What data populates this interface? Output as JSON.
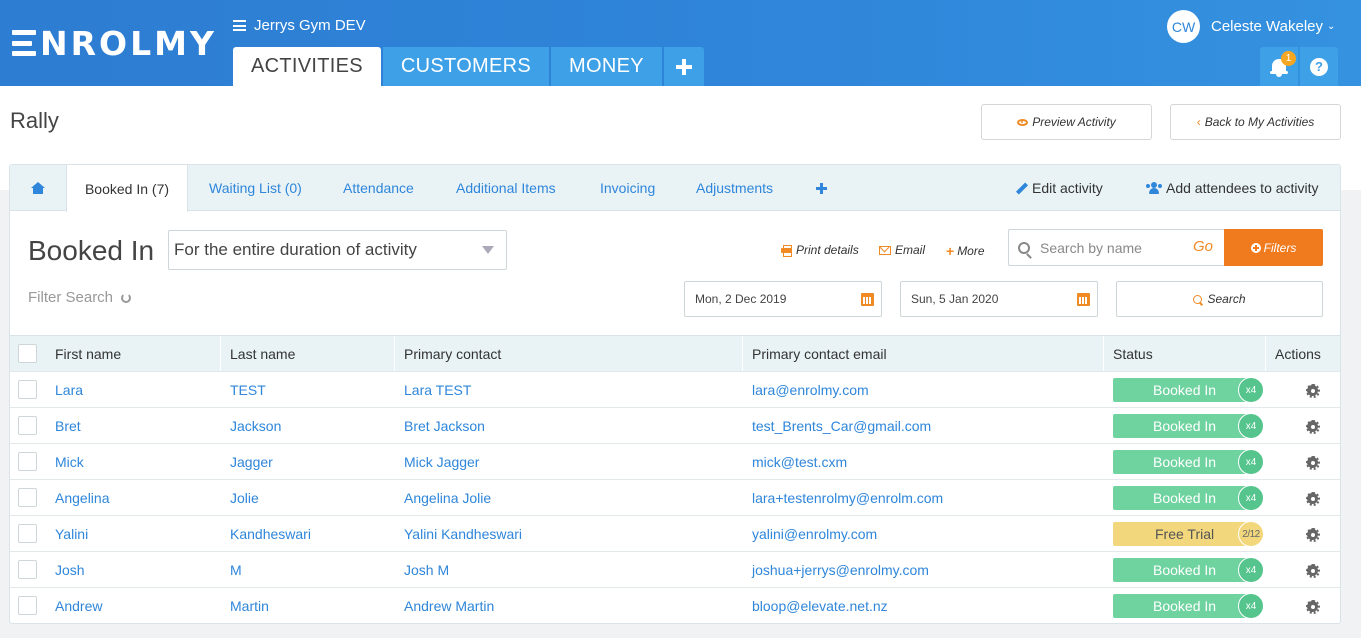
{
  "header": {
    "logo_text": "NROLMY",
    "gym_name": "Jerrys Gym DEV",
    "tabs": [
      {
        "label": "ACTIVITIES"
      },
      {
        "label": "CUSTOMERS"
      },
      {
        "label": "MONEY"
      }
    ],
    "user": {
      "initials": "CW",
      "name": "Celeste Wakeley"
    },
    "notification_count": "1",
    "help_label": "?"
  },
  "page": {
    "title": "Rally",
    "preview_label": "Preview Activity",
    "back_label": "Back to My Activities"
  },
  "subtabs": {
    "items": [
      {
        "label": "Booked In (7)"
      },
      {
        "label": "Waiting List (0)"
      },
      {
        "label": "Attendance"
      },
      {
        "label": "Additional Items"
      },
      {
        "label": "Invoicing"
      },
      {
        "label": "Adjustments"
      }
    ],
    "edit_label": "Edit activity",
    "add_attendees_label": "Add attendees to activity"
  },
  "section": {
    "title": "Booked In",
    "duration_value": "For the entire duration of activity",
    "print_label": "Print details",
    "email_label": "Email",
    "more_label": "More",
    "search_placeholder": "Search by name",
    "go_label": "Go",
    "filters_label": "Filters",
    "filter_search_label": "Filter Search",
    "date_start": "Mon, 2 Dec 2019",
    "date_end": "Sun, 5 Jan 2020",
    "search_button_label": "Search"
  },
  "table": {
    "columns": [
      "First name",
      "Last name",
      "Primary contact",
      "Primary contact email",
      "Status",
      "Actions"
    ],
    "rows": [
      {
        "first": "Lara",
        "last": "TEST",
        "contact": "Lara TEST",
        "email": "lara@enrolmy.com",
        "status": "Booked In",
        "count": "x4"
      },
      {
        "first": "Bret",
        "last": "Jackson",
        "contact": "Bret Jackson",
        "email": "test_Brents_Car@gmail.com",
        "status": "Booked In",
        "count": "x4"
      },
      {
        "first": "Mick",
        "last": "Jagger",
        "contact": "Mick Jagger",
        "email": "mick@test.cxm",
        "status": "Booked In",
        "count": "x4"
      },
      {
        "first": "Angelina",
        "last": "Jolie",
        "contact": "Angelina Jolie",
        "email": "lara+testenrolmy@enrolm.com",
        "status": "Booked In",
        "count": "x4"
      },
      {
        "first": "Yalini",
        "last": "Kandheswari",
        "contact": "Yalini Kandheswari",
        "email": "yalini@enrolmy.com",
        "status": "Free Trial",
        "count": "2/12"
      },
      {
        "first": "Josh",
        "last": "M",
        "contact": "Josh M",
        "email": "joshua+jerrys@enrolmy.com",
        "status": "Booked In",
        "count": "x4"
      },
      {
        "first": "Andrew",
        "last": "Martin",
        "contact": "Andrew Martin",
        "email": "bloop@elevate.net.nz",
        "status": "Booked In",
        "count": "x4"
      }
    ]
  },
  "colors": {
    "brand_blue": "#2f86da",
    "accent_orange": "#f07a1e",
    "booked_green": "#6fd3a0",
    "trial_yellow": "#f2d77c"
  }
}
